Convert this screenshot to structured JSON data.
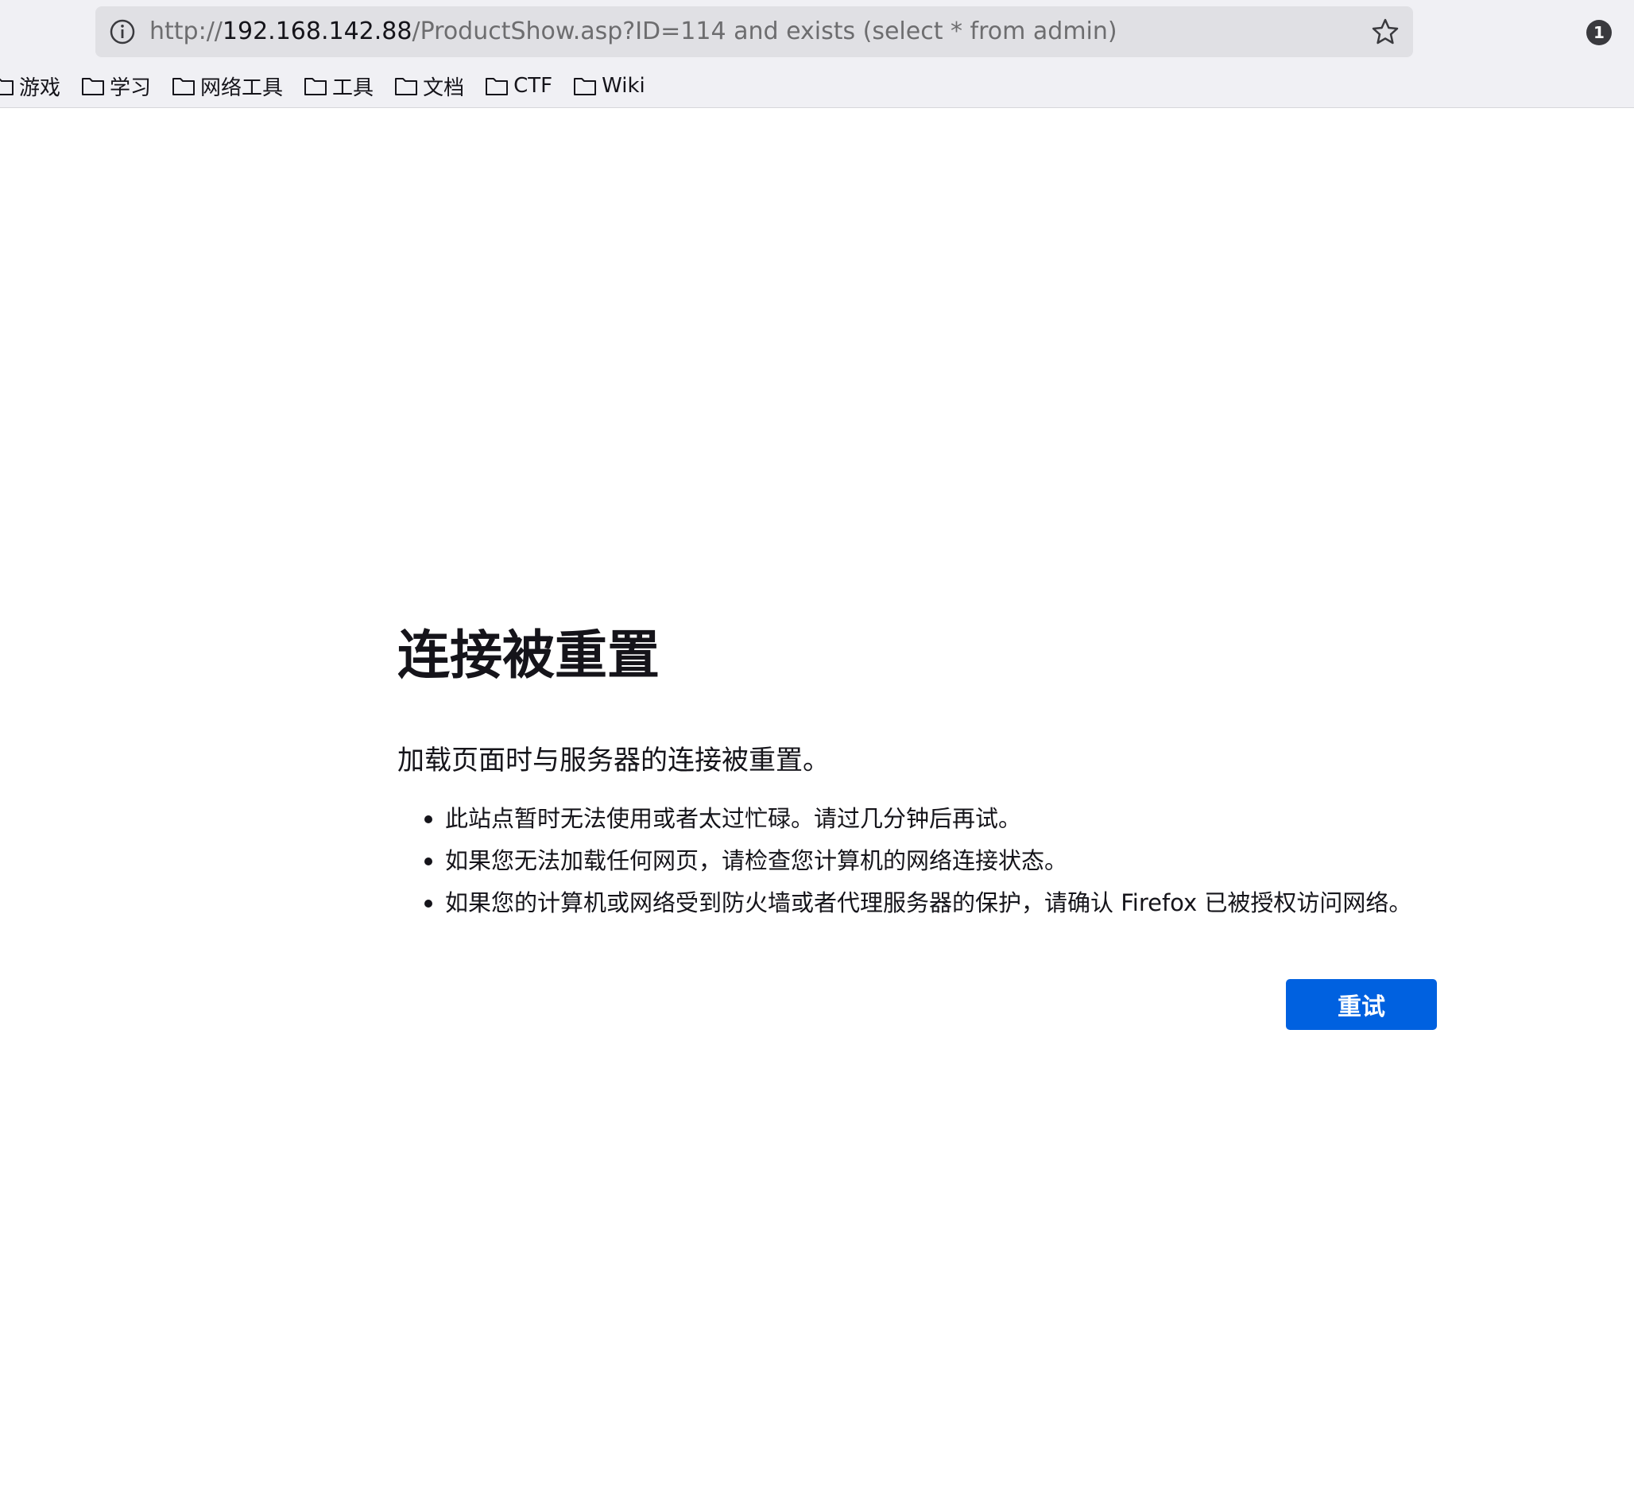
{
  "browser": {
    "url": {
      "scheme": "http://",
      "host": "192.168.142.88",
      "path": "/ProductShow.asp?ID=114 and exists (select * from admin)"
    },
    "notification_count": "1",
    "bookmarks": [
      {
        "label": "游戏",
        "icon": "folder-icon"
      },
      {
        "label": "学习",
        "icon": "folder-icon"
      },
      {
        "label": "网络工具",
        "icon": "folder-icon"
      },
      {
        "label": "工具",
        "icon": "folder-icon"
      },
      {
        "label": "文档",
        "icon": "folder-icon"
      },
      {
        "label": "CTF",
        "icon": "folder-icon"
      },
      {
        "label": "Wiki",
        "icon": "folder-icon"
      }
    ]
  },
  "error_page": {
    "title": "连接被重置",
    "description": "加载页面时与服务器的连接被重置。",
    "tips": [
      "此站点暂时无法使用或者太过忙碌。请过几分钟后再试。",
      "如果您无法加载任何网页，请检查您计算机的网络连接状态。",
      "如果您的计算机或网络受到防火墙或者代理服务器的保护，请确认 Firefox 已被授权访问网络。"
    ],
    "retry_label": "重试"
  },
  "colors": {
    "accent": "#0061e0",
    "chrome_bg": "#f0f0f4",
    "urlbar_bg": "#e0e0e4",
    "text": "#15141a"
  }
}
